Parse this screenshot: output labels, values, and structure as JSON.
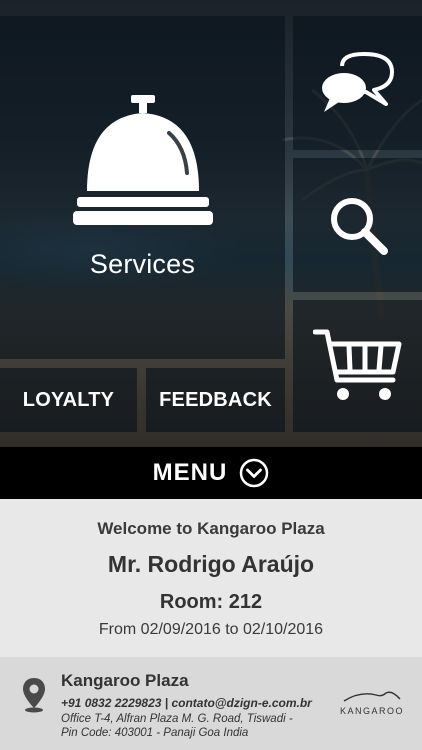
{
  "tiles": {
    "services": "Services",
    "loyalty": "LOYALTY",
    "feedback": "FEEDBACK"
  },
  "icons": {
    "services": "bell-icon",
    "chat": "chat-icon",
    "search": "search-icon",
    "cart": "cart-icon",
    "menu": "chevron-down-circle-icon",
    "location": "location-pin-icon"
  },
  "menu": {
    "label": "MENU"
  },
  "welcome": {
    "greeting": "Welcome to Kangaroo Plaza",
    "guest_name": "Mr. Rodrigo Araújo",
    "room": "Room: 212",
    "stay": "From 02/09/2016 to 02/10/2016"
  },
  "footer": {
    "hotel_name": "Kangaroo Plaza",
    "contact": "+91 0832 2229823 | contato@dzign-e.com.br",
    "address_line1": "Office T-4, Alfran Plaza M. G. Road, Tiswadi -",
    "address_line2": "Pin Code: 403001 - Panaji Goa India",
    "brand": "KANGAROO"
  },
  "colors": {
    "tile_overlay": "#08121a",
    "menu_bar": "#000000",
    "welcome_bg": "#e8e8e8",
    "footer_bg": "#d9d9d9",
    "text_dark": "#333333"
  }
}
